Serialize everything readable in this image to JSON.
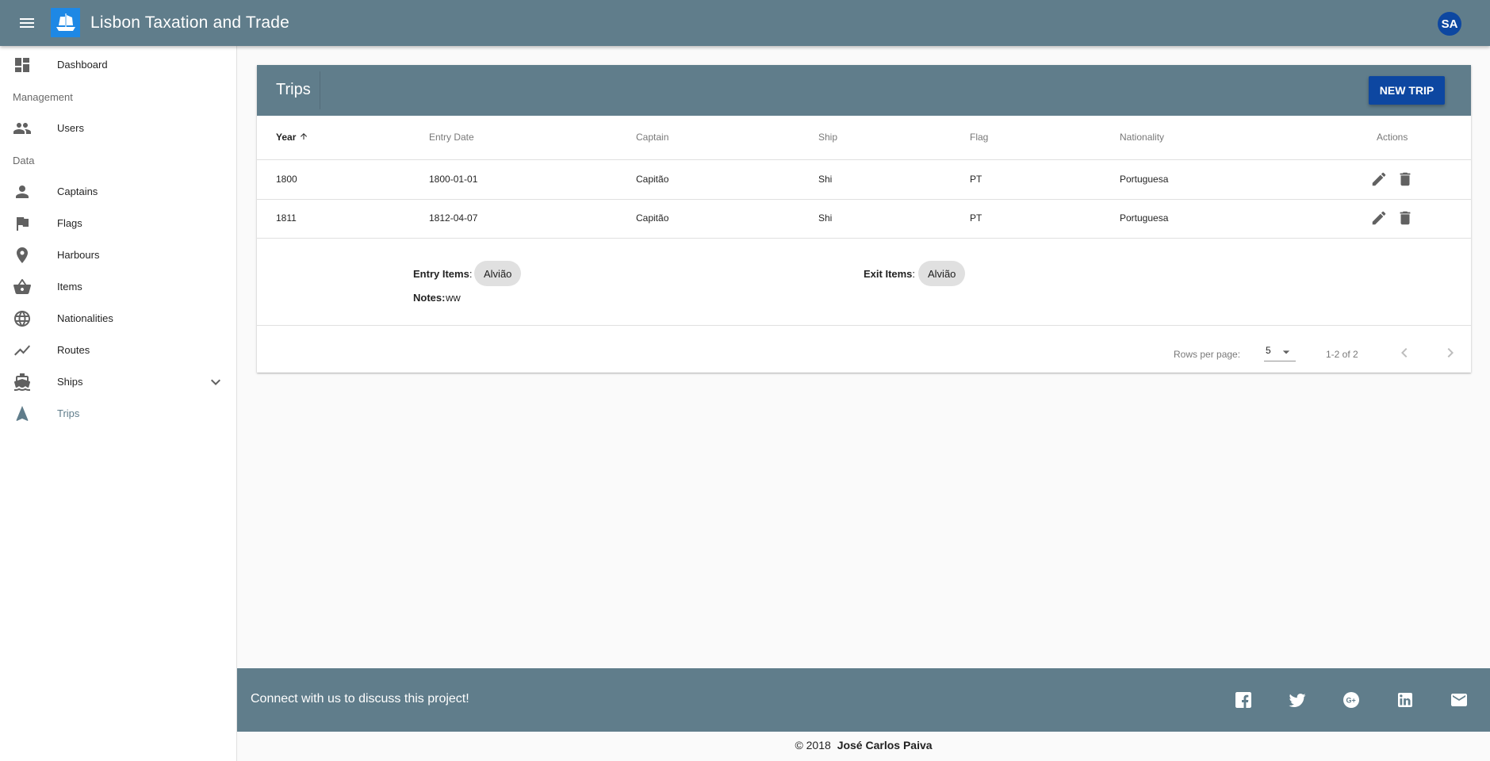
{
  "app": {
    "title": "Lisbon Taxation and Trade",
    "user_initials": "SA",
    "menu_icon": "menu-icon",
    "logo_icon": "ship-logo-icon",
    "colors": {
      "primary": "#607d8b",
      "accent": "#0d47a1",
      "logo_bg": "#1e88e5"
    }
  },
  "sidebar": {
    "dashboard": {
      "label": "Dashboard",
      "icon": "dashboard-icon"
    },
    "management_header": "Management",
    "users": {
      "label": "Users",
      "icon": "people-icon"
    },
    "data_header": "Data",
    "items": [
      {
        "label": "Captains",
        "icon": "person-icon"
      },
      {
        "label": "Flags",
        "icon": "flag-icon"
      },
      {
        "label": "Harbours",
        "icon": "location-pin-icon"
      },
      {
        "label": "Items",
        "icon": "basket-icon"
      },
      {
        "label": "Nationalities",
        "icon": "globe-icon"
      },
      {
        "label": "Routes",
        "icon": "trending-line-icon"
      },
      {
        "label": "Ships",
        "icon": "boat-icon"
      },
      {
        "label": "Trips",
        "icon": "navigation-arrow-icon"
      }
    ],
    "active": "Trips"
  },
  "trips": {
    "title": "Trips",
    "new_button": "NEW TRIP",
    "columns": [
      "Year",
      "Entry Date",
      "Captain",
      "Ship",
      "Flag",
      "Nationality",
      "Actions"
    ],
    "sort_column": "Year",
    "sort_direction": "ascending",
    "rows": [
      {
        "year": "1800",
        "entry_date": "1800-01-01",
        "captain": "Capitão",
        "ship": "Shi",
        "flag": "PT",
        "nationality": "Portuguesa"
      },
      {
        "year": "1811",
        "entry_date": "1812-04-07",
        "captain": "Capitão",
        "ship": "Shi",
        "flag": "PT",
        "nationality": "Portuguesa"
      }
    ],
    "detail": {
      "entry_items_label": "Entry Items",
      "entry_items": [
        "Alvião"
      ],
      "exit_items_label": "Exit Items",
      "exit_items": [
        "Alvião"
      ],
      "notes_label": "Notes:",
      "notes": "ww"
    },
    "pagination": {
      "rows_per_page_label": "Rows per page:",
      "rows_per_page": "5",
      "range": "1-2 of 2"
    }
  },
  "footer": {
    "text": "Connect with us to discuss this project!",
    "social_icons": [
      "facebook-icon",
      "twitter-icon",
      "google-plus-icon",
      "linkedin-icon",
      "email-icon"
    ],
    "copyright": "© 2018",
    "author": "José Carlos Paiva"
  }
}
